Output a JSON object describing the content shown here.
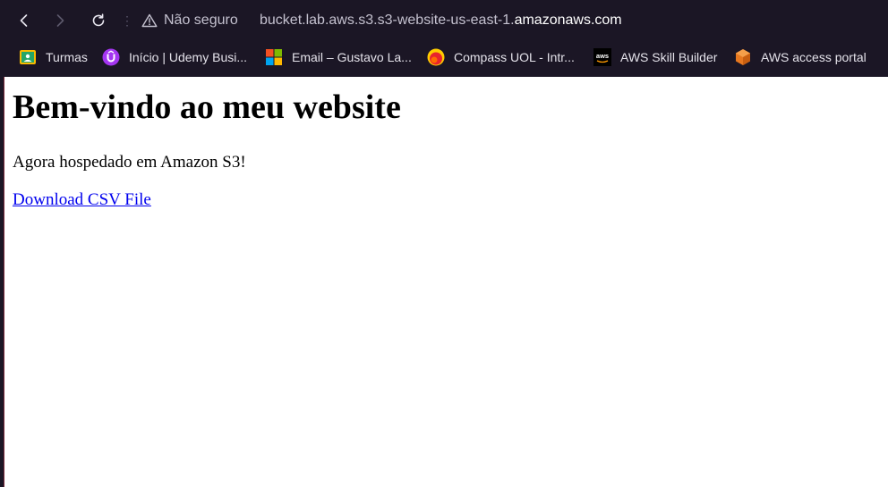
{
  "browser": {
    "security_label": "Não seguro",
    "url_prefix": "bucket.lab.aws.s3.s3-website-us-east-1.",
    "url_domain": "amazonaws.com",
    "bookmarks": [
      {
        "label": "Turmas",
        "icon": "google-classroom-icon"
      },
      {
        "label": "Início | Udemy Busi...",
        "icon": "udemy-icon"
      },
      {
        "label": "Email – Gustavo La...",
        "icon": "microsoft-icon"
      },
      {
        "label": "Compass UOL - Intr...",
        "icon": "compass-uol-icon"
      },
      {
        "label": "AWS Skill Builder",
        "icon": "aws-icon"
      },
      {
        "label": "AWS access portal",
        "icon": "aws-cube-icon"
      }
    ]
  },
  "page": {
    "heading": "Bem-vindo ao meu website",
    "paragraph": "Agora hospedado em Amazon S3!",
    "link": "Download CSV File"
  },
  "colors": {
    "chrome_bg": "#1b1625",
    "link": "#0000ee"
  }
}
